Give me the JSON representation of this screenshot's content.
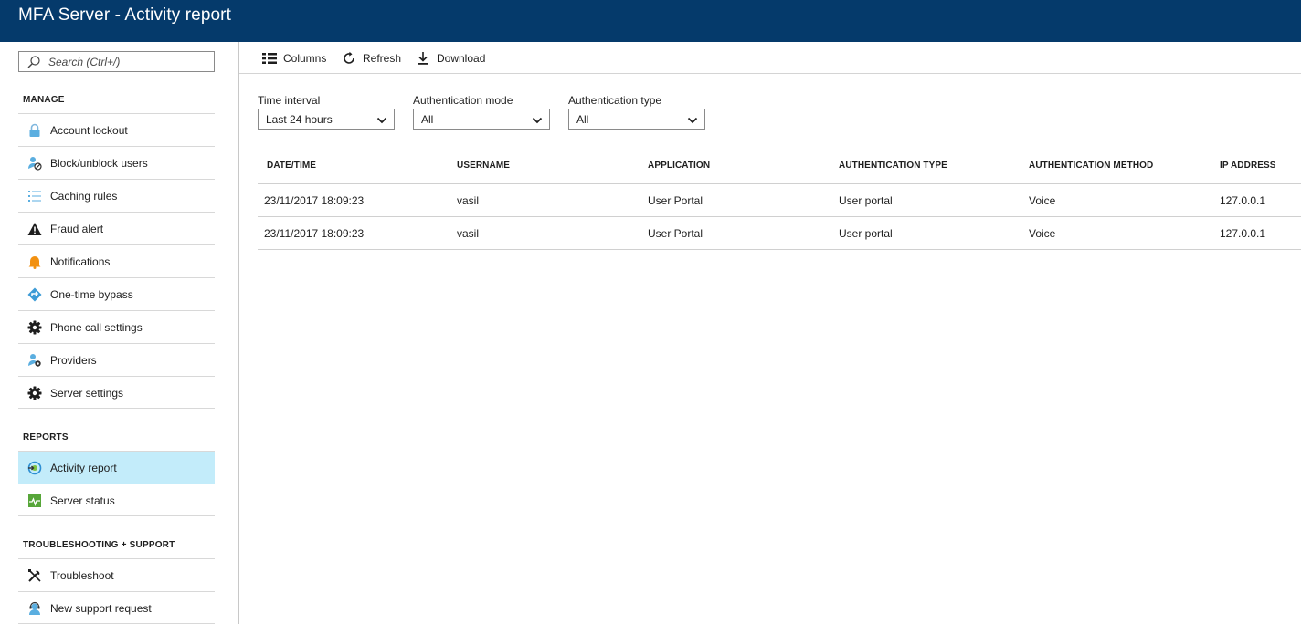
{
  "window": {
    "title": "MFA Server - Activity report"
  },
  "search": {
    "placeholder": "Search (Ctrl+/)"
  },
  "sidebar": {
    "sections": [
      {
        "label": "MANAGE"
      },
      {
        "label": "REPORTS"
      },
      {
        "label": "TROUBLESHOOTING + SUPPORT"
      }
    ],
    "items": [
      {
        "label": "Account lockout",
        "icon": "lock-icon"
      },
      {
        "label": "Block/unblock users",
        "icon": "user-block-icon"
      },
      {
        "label": "Caching rules",
        "icon": "list-icon"
      },
      {
        "label": "Fraud alert",
        "icon": "warning-icon"
      },
      {
        "label": "Notifications",
        "icon": "bell-icon"
      },
      {
        "label": "One-time bypass",
        "icon": "bypass-icon"
      },
      {
        "label": "Phone call settings",
        "icon": "gear-icon"
      },
      {
        "label": "Providers",
        "icon": "user-gear-icon"
      },
      {
        "label": "Server settings",
        "icon": "gear-icon"
      },
      {
        "label": "Activity report",
        "icon": "activity-icon",
        "selected": true
      },
      {
        "label": "Server status",
        "icon": "status-icon"
      },
      {
        "label": "Troubleshoot",
        "icon": "tools-icon"
      },
      {
        "label": "New support request",
        "icon": "support-icon"
      }
    ]
  },
  "toolbar": {
    "columns_label": "Columns",
    "refresh_label": "Refresh",
    "download_label": "Download"
  },
  "filters": {
    "time_interval": {
      "label": "Time interval",
      "value": "Last 24 hours"
    },
    "auth_mode": {
      "label": "Authentication mode",
      "value": "All"
    },
    "auth_type": {
      "label": "Authentication type",
      "value": "All"
    }
  },
  "table": {
    "columns": [
      "DATE/TIME",
      "USERNAME",
      "APPLICATION",
      "AUTHENTICATION TYPE",
      "AUTHENTICATION METHOD",
      "IP ADDRESS"
    ],
    "rows": [
      [
        "23/11/2017 18:09:23",
        "vasil",
        "User Portal",
        "User portal",
        "Voice",
        "127.0.0.1"
      ],
      [
        "23/11/2017 18:09:23",
        "vasil",
        "User Portal",
        "User portal",
        "Voice",
        "127.0.0.1"
      ]
    ]
  },
  "colors": {
    "titlebar": "#053a6b",
    "selected_nav": "#c3ecfa",
    "accent_blue": "#3d9bd6"
  }
}
